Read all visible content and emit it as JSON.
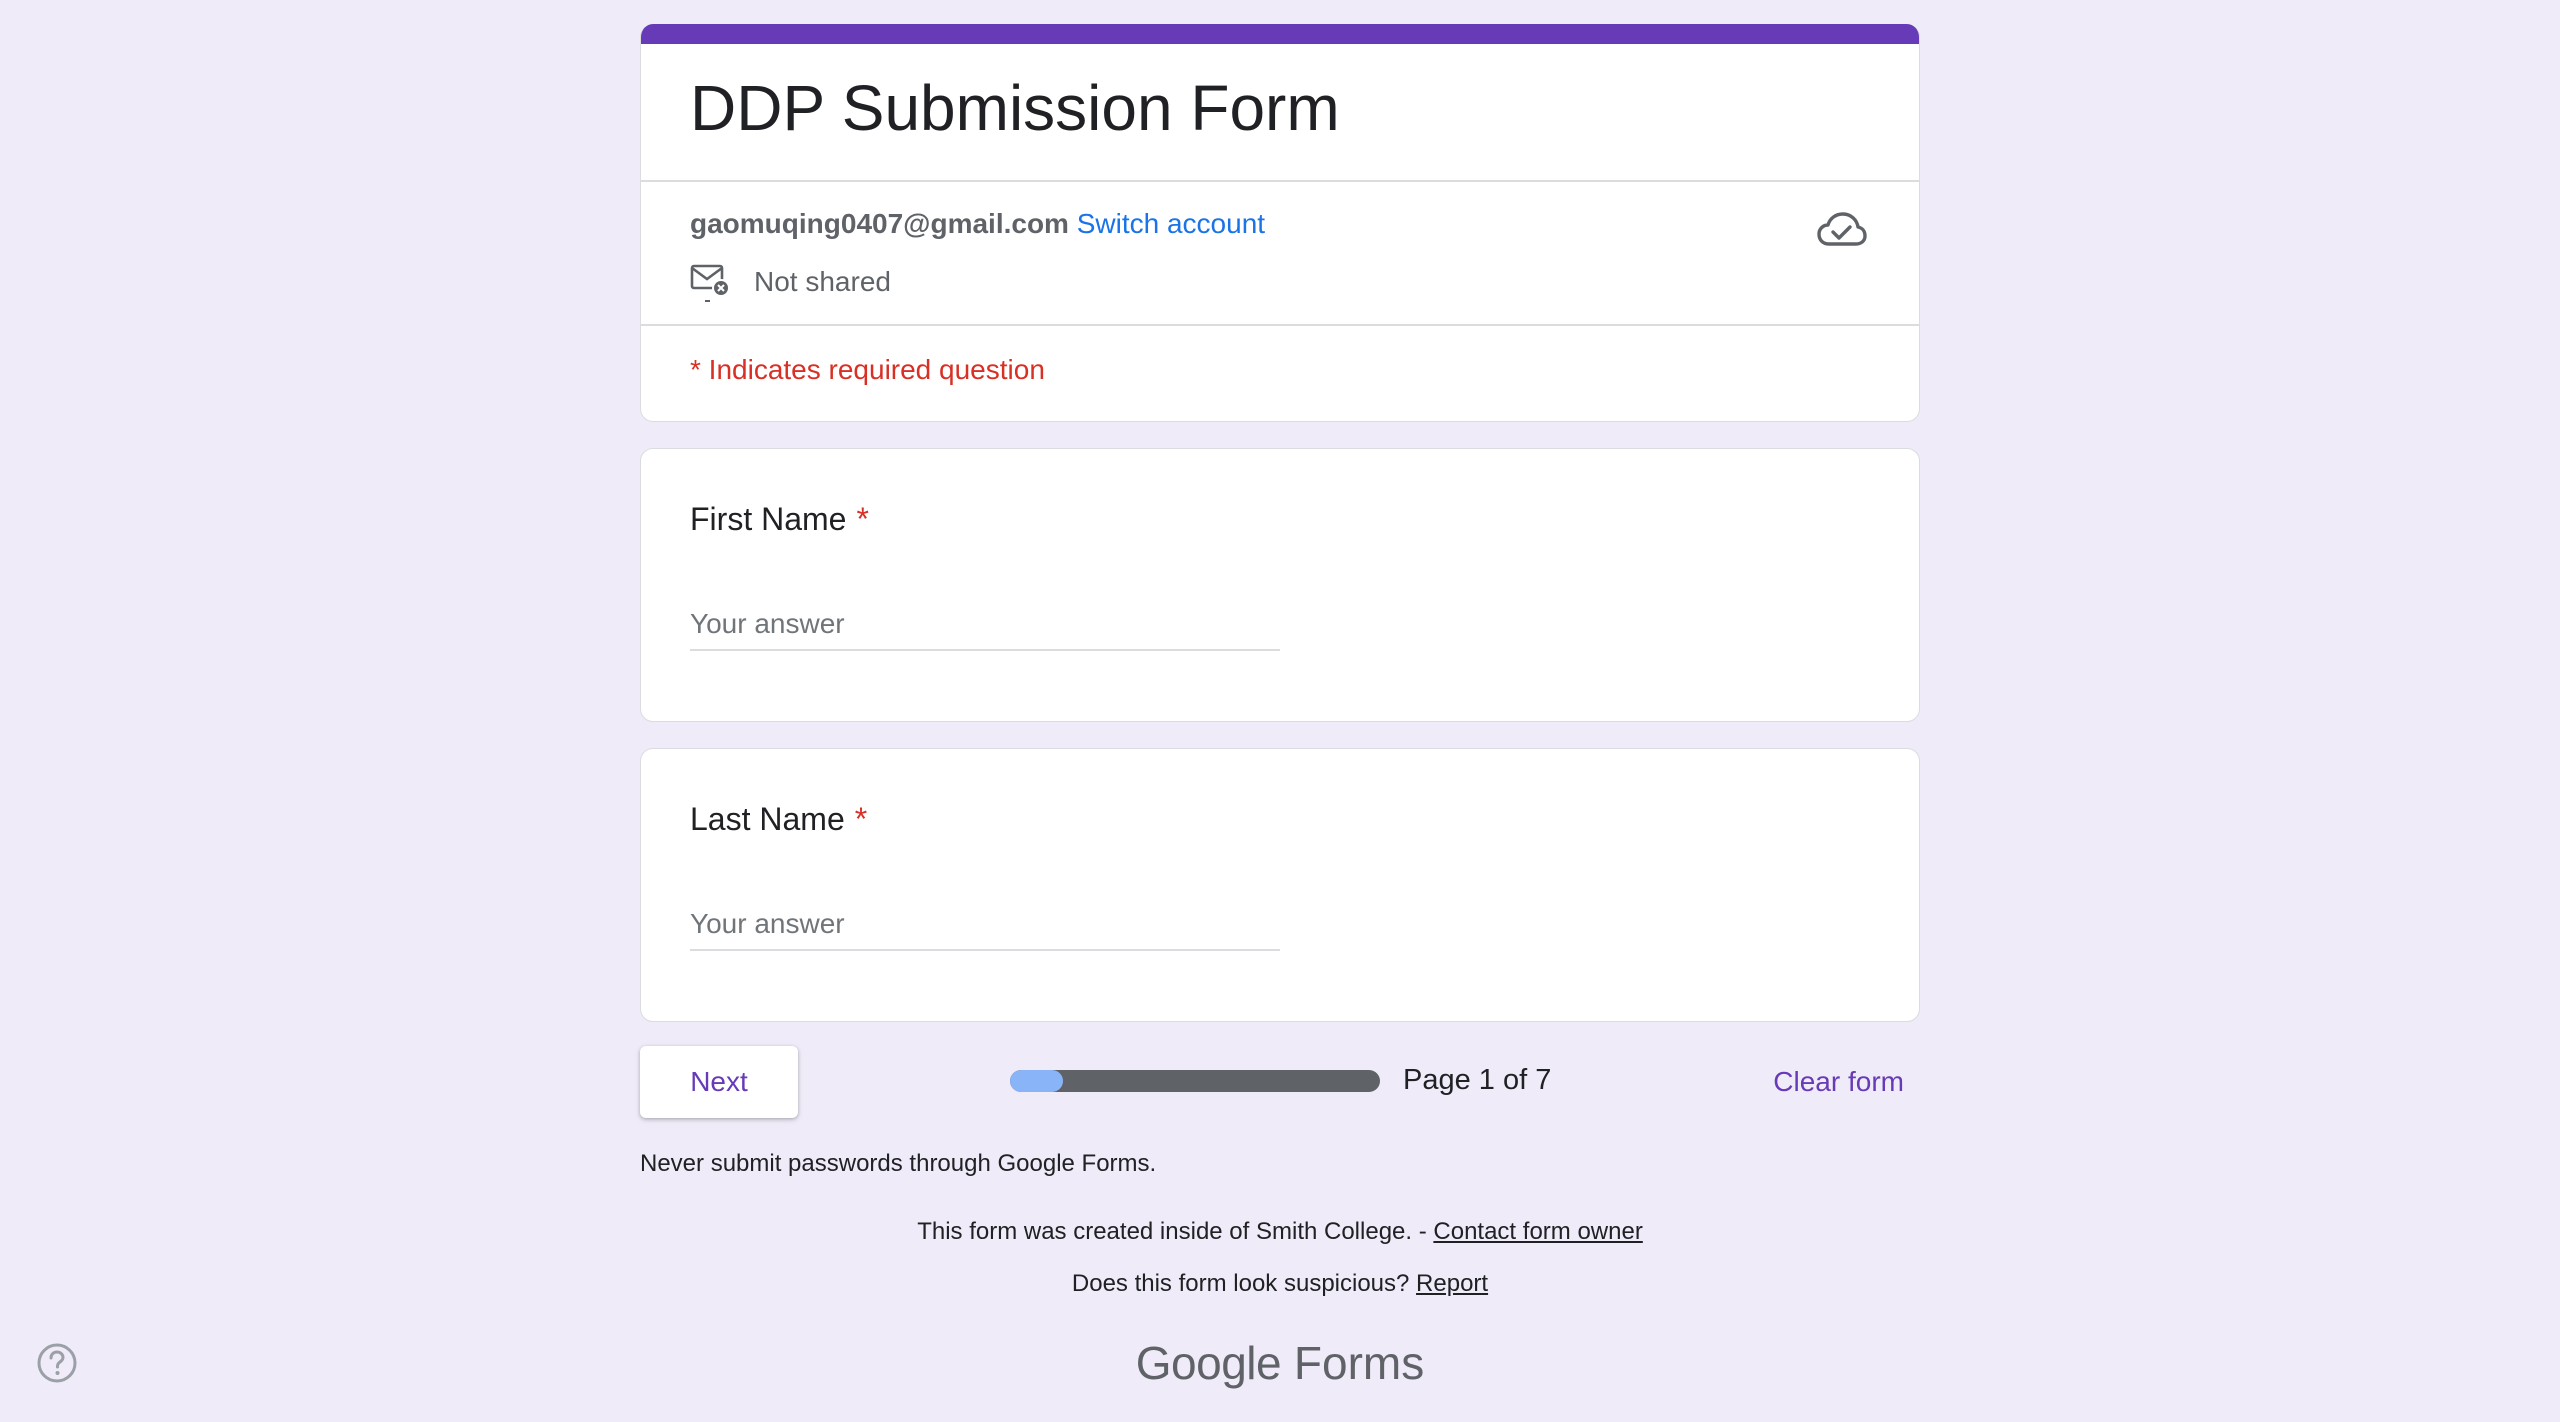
{
  "form": {
    "title": "DDP Submission Form",
    "accent_color": "#673ab7"
  },
  "account": {
    "email": "gaomuqing0407@gmail.com",
    "switch_label": "Switch account",
    "shared_status": "Not shared",
    "mail_icon": "mail-not-shared-icon",
    "save_icon": "cloud-done-icon"
  },
  "required_note": "* Indicates required question",
  "questions": [
    {
      "label": "First Name",
      "required_mark": "*",
      "placeholder": "Your answer"
    },
    {
      "label": "Last Name",
      "required_mark": "*",
      "placeholder": "Your answer"
    }
  ],
  "navigation": {
    "next_label": "Next",
    "page_indicator": "Page 1 of 7",
    "progress_fraction": 0.143,
    "clear_label": "Clear form"
  },
  "footer": {
    "password_warning": "Never submit passwords through Google Forms.",
    "created_text": "This form was created inside of Smith College. - ",
    "contact_link": "Contact form owner",
    "suspicious_text": "Does this form look suspicious? ",
    "report_link": "Report",
    "brand_google": "Google",
    "brand_forms": "Forms",
    "help_icon": "help-circle-icon"
  }
}
